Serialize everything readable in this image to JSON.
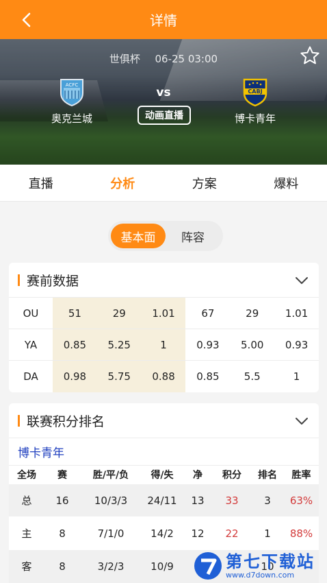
{
  "topbar": {
    "title": "详情"
  },
  "match": {
    "competition": "世俱杯",
    "datetime": "06-25 03:00",
    "home": "奥克兰城",
    "away": "博卡青年",
    "vs": "vs",
    "live_label": "动画直播",
    "home_badge_text": "ACFC",
    "away_badge_text": "CABJ"
  },
  "tabs": [
    "直播",
    "分析",
    "方案",
    "爆料"
  ],
  "active_tab": "分析",
  "segment": {
    "options": [
      "基本面",
      "阵容"
    ],
    "selected": "基本面"
  },
  "pre_match": {
    "title": "赛前数据",
    "rows": [
      {
        "label": "OU",
        "cells": [
          "51",
          "29",
          "1.01",
          "67",
          "29",
          "1.01"
        ]
      },
      {
        "label": "YA",
        "cells": [
          "0.85",
          "5.25",
          "1",
          "0.93",
          "5.00",
          "0.93"
        ]
      },
      {
        "label": "DA",
        "cells": [
          "0.98",
          "5.75",
          "0.88",
          "0.85",
          "5.5",
          "1"
        ]
      }
    ]
  },
  "standings": {
    "title": "联赛积分排名",
    "team": "博卡青年",
    "headers": [
      "全场",
      "赛",
      "胜/平/负",
      "得/失",
      "净",
      "积分",
      "排名",
      "胜率"
    ],
    "rows": [
      {
        "cells": [
          "总",
          "16",
          "10/3/3",
          "24/11",
          "13",
          "33",
          "3",
          "63%"
        ]
      },
      {
        "cells": [
          "主",
          "8",
          "7/1/0",
          "14/2",
          "12",
          "22",
          "1",
          "88%"
        ]
      },
      {
        "cells": [
          "客",
          "8",
          "3/2/3",
          "10/9",
          "",
          "",
          "10",
          ""
        ]
      }
    ]
  },
  "watermark": {
    "name": "第七下载站",
    "url": "www.d7down.com"
  },
  "colors": {
    "accent": "#ff8a14",
    "highlight": "#f6efdc",
    "link": "#1f3fbf",
    "red": "#d33a3a"
  }
}
